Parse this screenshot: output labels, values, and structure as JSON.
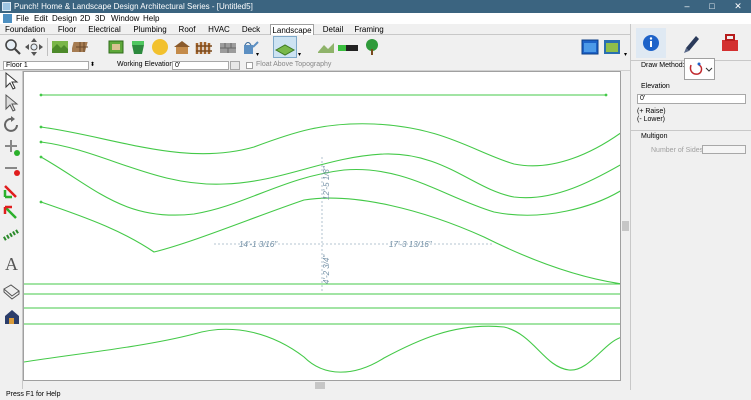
{
  "window": {
    "title": "Punch! Home & Landscape Design Architectural Series - [Untitled5]",
    "controls": [
      "–",
      "□",
      "✕"
    ]
  },
  "menu": [
    "File",
    "Edit",
    "Design",
    "2D",
    "3D",
    "Window",
    "Help"
  ],
  "tabs": {
    "items": [
      "Foundation",
      "Floor",
      "Electrical",
      "Plumbing",
      "Roof",
      "HVAC",
      "Deck",
      "Landscape",
      "Detail",
      "Framing"
    ],
    "active": "Landscape"
  },
  "toolbar": {
    "icons": [
      "zoom-tool-icon",
      "pan-tool-icon",
      "terrain-tool-icon",
      "paver-tool-icon",
      "planting-bed-icon",
      "sun-shade-icon",
      "gazebo-icon",
      "fence-icon",
      "wall-icon",
      "watering-can-icon",
      "terrain-grid-icon",
      "slab-tool-icon",
      "tree-tool-icon",
      "view-window-icon",
      "layout-window-icon"
    ]
  },
  "options_bar": {
    "floor_select": "Floor 1",
    "working_elevation_label": "Working Elevation:",
    "working_elevation_value": "0'",
    "float_above_label": "Float Above Topography",
    "float_above_checked": false
  },
  "left_tools": [
    "select-arrow-icon",
    "select-points-icon",
    "rotate-icon",
    "add-point-icon",
    "remove-point-icon",
    "add-elevation-icon",
    "lower-elevation-icon",
    "chain-icon",
    "text-tool-icon",
    "book-icon",
    "house-icon"
  ],
  "canvas": {
    "dimensions": [
      "12'-5 1/8\"",
      "14'-1 3/16\"",
      "17'-3 13/16\"",
      "4'-2 3/4\""
    ],
    "line_color": "#44c948"
  },
  "right_panel": {
    "tabs": [
      "info-icon",
      "pen-icon",
      "toolbox-icon"
    ],
    "draw_method_label": "Draw Method:",
    "elevation_heading": "Elevation",
    "elevation_value": "0'",
    "raise_note": "(+ Raise)",
    "lower_note": "(- Lower)",
    "multigon_heading": "Multigon",
    "number_of_sides_label": "Number of Sides:",
    "number_of_sides_value": ""
  },
  "status": "Press F1 for Help",
  "colors": {
    "title_bar": "#3b6480",
    "accent": "#0078d7",
    "contour": "#44c948",
    "dimension": "#7390a6"
  }
}
